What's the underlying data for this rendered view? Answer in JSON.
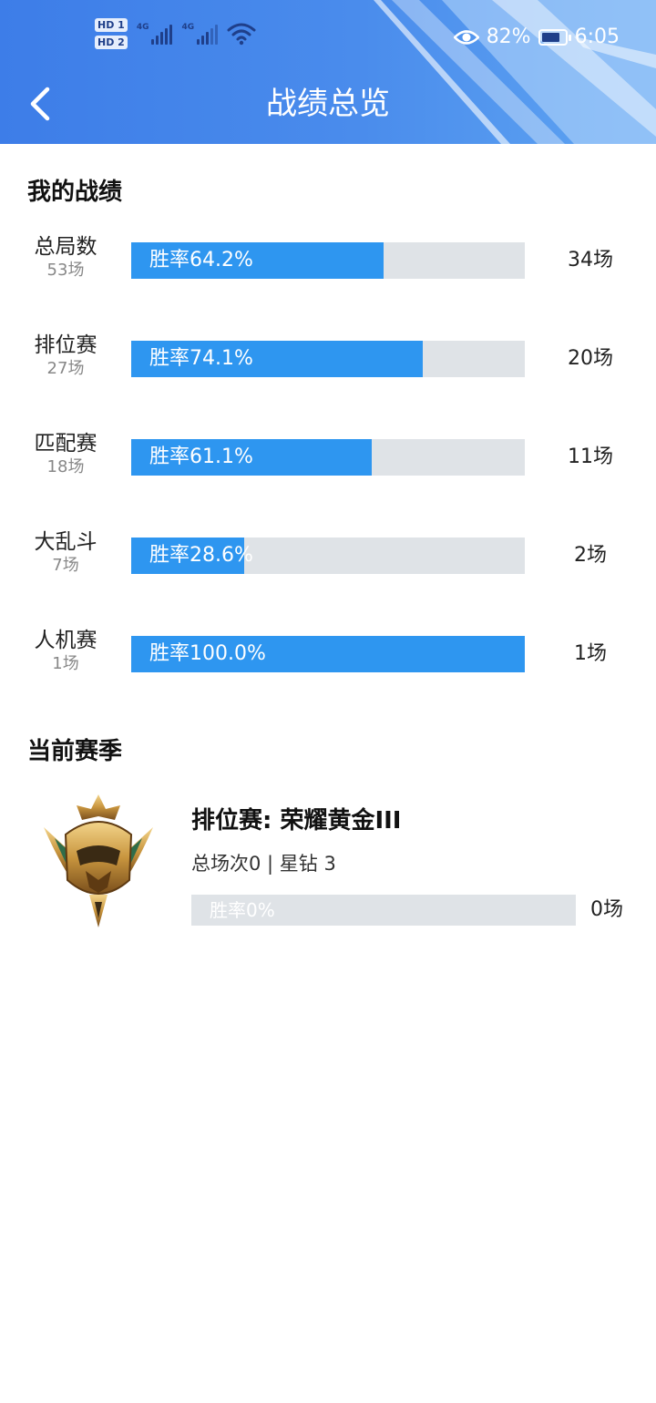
{
  "status_bar": {
    "hd1": "HD 1",
    "hd2": "HD 2",
    "net1": "4G",
    "net2": "4G",
    "battery_percent": "82%",
    "time": "6:05",
    "battery_level": 0.82
  },
  "header": {
    "title": "战绩总览"
  },
  "my_stats": {
    "title": "我的战绩",
    "rows": [
      {
        "name": "总局数",
        "count": "53场",
        "win_rate_label": "胜率64.2%",
        "win_rate": 64.2,
        "matches": "34场"
      },
      {
        "name": "排位赛",
        "count": "27场",
        "win_rate_label": "胜率74.1%",
        "win_rate": 74.1,
        "matches": "20场"
      },
      {
        "name": "匹配赛",
        "count": "18场",
        "win_rate_label": "胜率61.1%",
        "win_rate": 61.1,
        "matches": "11场"
      },
      {
        "name": "大乱斗",
        "count": "7场",
        "win_rate_label": "胜率28.6%",
        "win_rate": 28.6,
        "matches": "2场"
      },
      {
        "name": "人机赛",
        "count": "1场",
        "win_rate_label": "胜率100.0%",
        "win_rate": 100.0,
        "matches": "1场"
      }
    ]
  },
  "current_season": {
    "title": "当前赛季",
    "rank": "排位赛: 荣耀黄金III",
    "detail": "总场次0 | 星钻 3",
    "win_rate_label": "胜率0%",
    "win_rate": 0,
    "matches": "0场",
    "emblem_icon": "gold-rank-emblem"
  },
  "colors": {
    "header_start": "#3d7de8",
    "header_end": "#5fa5f2",
    "bar_fill": "#2e96f0",
    "bar_track": "#dfe3e7"
  }
}
